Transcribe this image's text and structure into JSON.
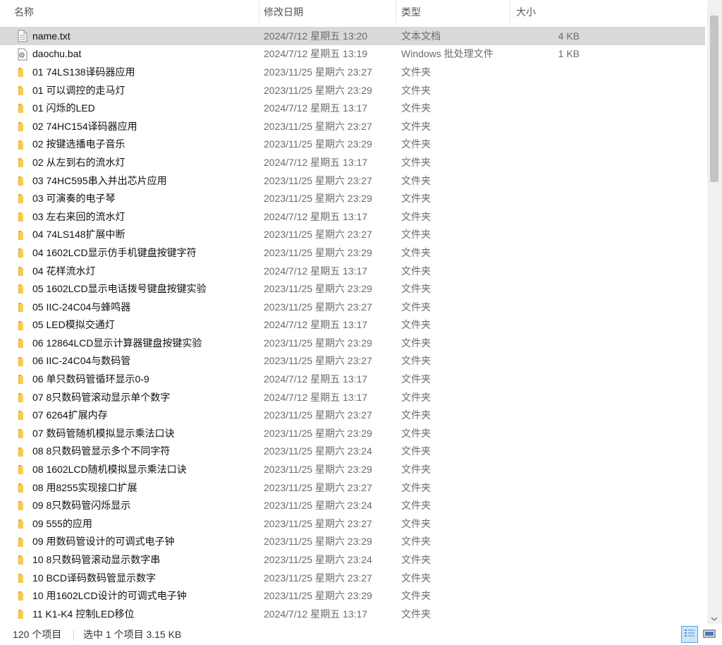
{
  "columns": {
    "name": "名称",
    "date": "修改日期",
    "type": "类型",
    "size": "大小"
  },
  "rows": [
    {
      "name": "name.txt",
      "date": "2024/7/12 星期五 13:20",
      "type": "文本文档",
      "size": "4 KB",
      "icon": "text-file-icon",
      "selected": true
    },
    {
      "name": "daochu.bat",
      "date": "2024/7/12 星期五 13:19",
      "type": "Windows 批处理文件",
      "size": "1 KB",
      "icon": "batch-file-icon"
    },
    {
      "name": "01 74LS138译码器应用",
      "date": "2023/11/25 星期六 23:27",
      "type": "文件夹",
      "size": "",
      "icon": "folder-icon"
    },
    {
      "name": "01 可以调控的走马灯",
      "date": "2023/11/25 星期六 23:29",
      "type": "文件夹",
      "size": "",
      "icon": "folder-icon"
    },
    {
      "name": "01 闪烁的LED",
      "date": "2024/7/12 星期五 13:17",
      "type": "文件夹",
      "size": "",
      "icon": "folder-icon"
    },
    {
      "name": "02 74HC154译码器应用",
      "date": "2023/11/25 星期六 23:27",
      "type": "文件夹",
      "size": "",
      "icon": "folder-icon"
    },
    {
      "name": "02 按键选播电子音乐",
      "date": "2023/11/25 星期六 23:29",
      "type": "文件夹",
      "size": "",
      "icon": "folder-icon"
    },
    {
      "name": "02 从左到右的流水灯",
      "date": "2024/7/12 星期五 13:17",
      "type": "文件夹",
      "size": "",
      "icon": "folder-icon"
    },
    {
      "name": "03 74HC595串入并出芯片应用",
      "date": "2023/11/25 星期六 23:27",
      "type": "文件夹",
      "size": "",
      "icon": "folder-icon"
    },
    {
      "name": "03 可演奏的电子琴",
      "date": "2023/11/25 星期六 23:29",
      "type": "文件夹",
      "size": "",
      "icon": "folder-icon"
    },
    {
      "name": "03 左右来回的流水灯",
      "date": "2024/7/12 星期五 13:17",
      "type": "文件夹",
      "size": "",
      "icon": "folder-icon"
    },
    {
      "name": "04 74LS148扩展中断",
      "date": "2023/11/25 星期六 23:27",
      "type": "文件夹",
      "size": "",
      "icon": "folder-icon"
    },
    {
      "name": "04 1602LCD显示仿手机键盘按键字符",
      "date": "2023/11/25 星期六 23:29",
      "type": "文件夹",
      "size": "",
      "icon": "folder-icon"
    },
    {
      "name": "04 花样流水灯",
      "date": "2024/7/12 星期五 13:17",
      "type": "文件夹",
      "size": "",
      "icon": "folder-icon"
    },
    {
      "name": "05 1602LCD显示电话拨号键盘按键实验",
      "date": "2023/11/25 星期六 23:29",
      "type": "文件夹",
      "size": "",
      "icon": "folder-icon"
    },
    {
      "name": "05 IIC-24C04与蜂鸣器",
      "date": "2023/11/25 星期六 23:27",
      "type": "文件夹",
      "size": "",
      "icon": "folder-icon"
    },
    {
      "name": "05 LED模拟交通灯",
      "date": "2024/7/12 星期五 13:17",
      "type": "文件夹",
      "size": "",
      "icon": "folder-icon"
    },
    {
      "name": "06 12864LCD显示计算器键盘按键实验",
      "date": "2023/11/25 星期六 23:29",
      "type": "文件夹",
      "size": "",
      "icon": "folder-icon"
    },
    {
      "name": "06 IIC-24C04与数码管",
      "date": "2023/11/25 星期六 23:27",
      "type": "文件夹",
      "size": "",
      "icon": "folder-icon"
    },
    {
      "name": "06 单只数码管循环显示0-9",
      "date": "2024/7/12 星期五 13:17",
      "type": "文件夹",
      "size": "",
      "icon": "folder-icon"
    },
    {
      "name": "07 8只数码管滚动显示单个数字",
      "date": "2024/7/12 星期五 13:17",
      "type": "文件夹",
      "size": "",
      "icon": "folder-icon"
    },
    {
      "name": "07 6264扩展内存",
      "date": "2023/11/25 星期六 23:27",
      "type": "文件夹",
      "size": "",
      "icon": "folder-icon"
    },
    {
      "name": "07 数码管随机模拟显示乘法口诀",
      "date": "2023/11/25 星期六 23:29",
      "type": "文件夹",
      "size": "",
      "icon": "folder-icon"
    },
    {
      "name": "08 8只数码管显示多个不同字符",
      "date": "2023/11/25 星期六 23:24",
      "type": "文件夹",
      "size": "",
      "icon": "folder-icon"
    },
    {
      "name": "08 1602LCD随机模拟显示乘法口诀",
      "date": "2023/11/25 星期六 23:29",
      "type": "文件夹",
      "size": "",
      "icon": "folder-icon"
    },
    {
      "name": "08 用8255实现接口扩展",
      "date": "2023/11/25 星期六 23:27",
      "type": "文件夹",
      "size": "",
      "icon": "folder-icon"
    },
    {
      "name": "09 8只数码管闪烁显示",
      "date": "2023/11/25 星期六 23:24",
      "type": "文件夹",
      "size": "",
      "icon": "folder-icon"
    },
    {
      "name": "09 555的应用",
      "date": "2023/11/25 星期六 23:27",
      "type": "文件夹",
      "size": "",
      "icon": "folder-icon"
    },
    {
      "name": "09 用数码管设计的可调式电子钟",
      "date": "2023/11/25 星期六 23:29",
      "type": "文件夹",
      "size": "",
      "icon": "folder-icon"
    },
    {
      "name": "10 8只数码管滚动显示数字串",
      "date": "2023/11/25 星期六 23:24",
      "type": "文件夹",
      "size": "",
      "icon": "folder-icon"
    },
    {
      "name": "10 BCD译码数码管显示数字",
      "date": "2023/11/25 星期六 23:27",
      "type": "文件夹",
      "size": "",
      "icon": "folder-icon"
    },
    {
      "name": "10 用1602LCD设计的可调式电子钟",
      "date": "2023/11/25 星期六 23:29",
      "type": "文件夹",
      "size": "",
      "icon": "folder-icon"
    },
    {
      "name": "11 K1-K4 控制LED移位",
      "date": "2024/7/12 星期五 13:17",
      "type": "文件夹",
      "size": "",
      "icon": "folder-icon"
    }
  ],
  "status": {
    "count": "120 个项目",
    "selection": "选中 1 个项目  3.15 KB"
  },
  "colors": {
    "selected_row": "#d9d9d9",
    "folder": "#f2c04d",
    "accent": "#5aa0e6"
  }
}
